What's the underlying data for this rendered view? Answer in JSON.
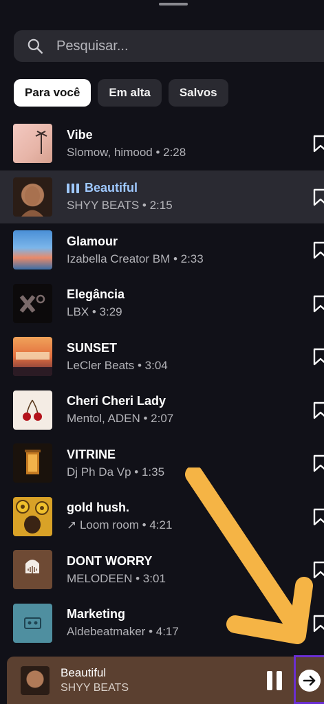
{
  "search": {
    "placeholder": "Pesquisar..."
  },
  "tabs": [
    {
      "label": "Para você",
      "active": true
    },
    {
      "label": "Em alta",
      "active": false
    },
    {
      "label": "Salvos",
      "active": false
    }
  ],
  "tracks": [
    {
      "title": "Vibe",
      "subtitle": "Slomow, himood • 2:28"
    },
    {
      "title": "Beautiful",
      "subtitle": "SHYY BEATS • 2:15",
      "playing": true
    },
    {
      "title": "Glamour",
      "subtitle": "Izabella Creator BM • 2:33"
    },
    {
      "title": "Elegância",
      "subtitle": "LBX • 3:29"
    },
    {
      "title": "SUNSET",
      "subtitle": "LeCler Beats • 3:04"
    },
    {
      "title": "Cheri Cheri Lady",
      "subtitle": "Mentol, ADEN • 2:07"
    },
    {
      "title": "VITRINE",
      "subtitle": "Dj Ph Da Vp • 1:35"
    },
    {
      "title": "gold hush.",
      "subtitle": "↗ Loom room • 4:21"
    },
    {
      "title": "DONT WORRY",
      "subtitle": "MELODEEN • 3:01"
    },
    {
      "title": "Marketing",
      "subtitle": "Aldebeatmaker • 4:17"
    }
  ],
  "now_playing": {
    "title": "Beautiful",
    "artist": "SHYY BEATS"
  },
  "colors": {
    "background": "#111118",
    "playing_accent": "#9fc9ff",
    "player_bar": "#5b4030",
    "highlight_box": "#6a2fd0",
    "annotation_arrow": "#f5b445"
  },
  "icons": {
    "search": "search-icon",
    "save": "bookmark-icon",
    "pause": "pause-icon",
    "next": "arrow-right-icon"
  }
}
